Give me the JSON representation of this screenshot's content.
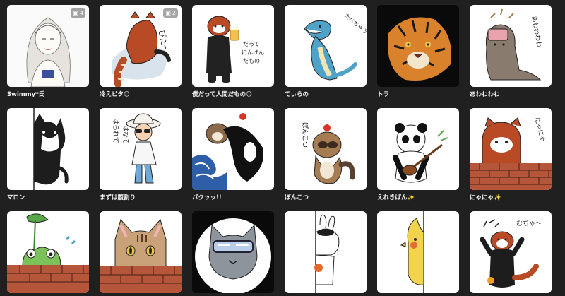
{
  "items": [
    {
      "caption": "Swimmy*氏",
      "emoji": "",
      "count": "4"
    },
    {
      "caption": "冷えピタ",
      "emoji": "😊",
      "count": "2"
    },
    {
      "caption": "僕だって人間だもの",
      "emoji": "😊",
      "count": ""
    },
    {
      "caption": "てぃらの",
      "emoji": "",
      "count": ""
    },
    {
      "caption": "トラ",
      "emoji": "",
      "count": ""
    },
    {
      "caption": "あわわわわ",
      "emoji": "",
      "count": ""
    },
    {
      "caption": "マロン",
      "emoji": "",
      "count": ""
    },
    {
      "caption": "まずは腹割り",
      "emoji": "",
      "count": ""
    },
    {
      "caption": "バクッッ!!",
      "emoji": "",
      "count": ""
    },
    {
      "caption": "ぽんこつ",
      "emoji": "",
      "count": ""
    },
    {
      "caption": "えれきぱん",
      "emoji": "✨",
      "count": ""
    },
    {
      "caption": "にゃにゃ",
      "emoji": "✨",
      "count": ""
    },
    {
      "caption": "",
      "emoji": "",
      "count": ""
    },
    {
      "caption": "",
      "emoji": "",
      "count": ""
    },
    {
      "caption": "",
      "emoji": "",
      "count": ""
    },
    {
      "caption": "",
      "emoji": "",
      "count": ""
    },
    {
      "caption": "",
      "emoji": "",
      "count": ""
    },
    {
      "caption": "",
      "emoji": "",
      "count": ""
    }
  ],
  "art_text": {
    "hiepita": "ぴた〜",
    "human": [
      "だって",
      "にんげん",
      "だもの"
    ],
    "tyra": "たべちゃうぞ",
    "awawa": "あわわわわ",
    "harawatte": [
      "はられて",
      "はなそ"
    ],
    "ponkotsu": "ぽんこつ",
    "nyanya": "にゃにゃ",
    "mucha": "むちゃ〜"
  },
  "colors": {
    "background": "#202020",
    "card": "#ffffff",
    "caption": "#f2f2f2",
    "red_panda": "#b84a25",
    "brick": "#b5553a"
  },
  "icons": {
    "count_badge": "images-icon"
  }
}
